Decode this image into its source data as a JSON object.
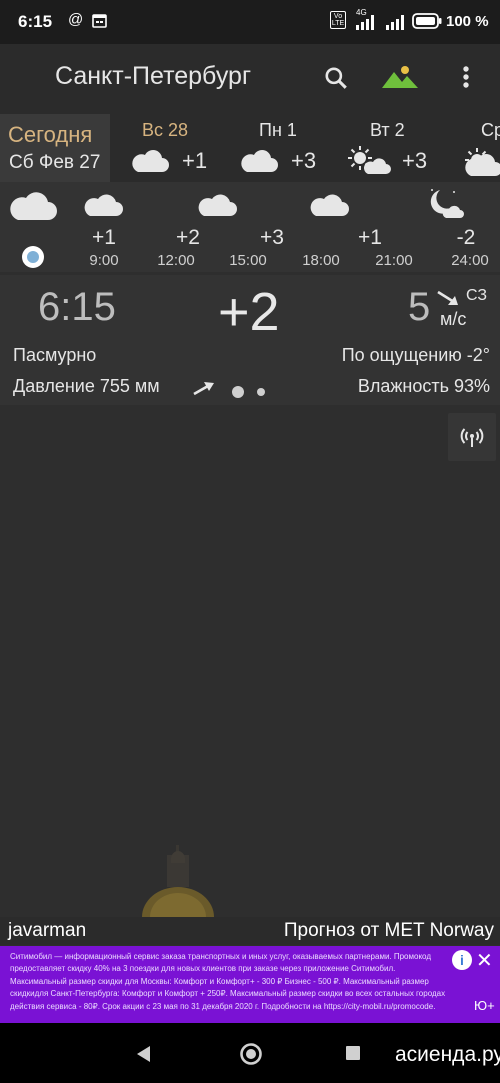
{
  "status_bar": {
    "time": "6:15",
    "at_icon": "@",
    "battery_percent": "100 %",
    "net_label": "4G",
    "volte_label": "Vo LTE"
  },
  "app_bar": {
    "city": "Санкт-Петербург",
    "icons": [
      "search-icon",
      "landscape-icon",
      "more-vert-icon"
    ],
    "accent_landscape_color": "#6fbf3c"
  },
  "days": {
    "today": {
      "label": "Сегодня",
      "date": "Сб Фев 27"
    },
    "list": [
      {
        "label": "Вс 28",
        "temp": "+1",
        "icon": "cloud-icon"
      },
      {
        "label": "Пн 1",
        "temp": "+3",
        "icon": "cloud-icon"
      },
      {
        "label": "Вт 2",
        "temp": "+3",
        "icon": "sun-cloud-icon"
      },
      {
        "label": "Ср",
        "temp": "",
        "icon": "cloud-icon"
      }
    ],
    "today_color": "#d7b480"
  },
  "hourly": [
    {
      "temp": "+1",
      "time": "9:00",
      "icon": "cloud-icon"
    },
    {
      "temp": "+2",
      "time": "12:00",
      "icon": "cloud-icon"
    },
    {
      "temp": "+3",
      "time": "15:00",
      "icon": "cloud-icon"
    },
    {
      "temp": "+1",
      "time": "18:00",
      "icon": "cloud-icon"
    },
    {
      "temp": "+1",
      "time": "21:00",
      "icon": "cloud-icon"
    },
    {
      "temp": "-2",
      "time": "24:00",
      "icon": "moon-cloud-icon"
    }
  ],
  "current": {
    "time": "6:15",
    "temp": "+2",
    "wind_speed": "5",
    "wind_unit": "м/с",
    "wind_dir": "СЗ",
    "condition": "Пасмурно",
    "feels_like": "По ощущению -2°",
    "pressure": "Давление 755 мм",
    "humidity": "Влажность 93%"
  },
  "credits": {
    "left": "javarman",
    "right": "Прогноз от MET Norway"
  },
  "ad": {
    "text": "Ситимобил — информационный сервис заказа транспортных и иных услуг, оказываемых партнерами. Промокод предоставляет скидку 40% на 3 поездки для новых клиентов при заказе через приложение Ситимобил. Максимальный размер скидки для Москвы: Комфорт и Комфорт+ - 300 ₽ Бизнес - 500 ₽. Максимальный размер скидкидля Санкт-Петербурга: Комфорт и Комфорт + 250₽. Максимальный размер скидки во всех остальных городах действия сервиса - 80₽. Срок акции с 23 мая по 31 декабря 2020 г. Подробности на https://city-mobil.ru/promocode.",
    "info_glyph": "i",
    "close_glyph": "✕",
    "brand": "Ю+",
    "background": "#7a12d4"
  },
  "watermark": "асиенда.ру"
}
